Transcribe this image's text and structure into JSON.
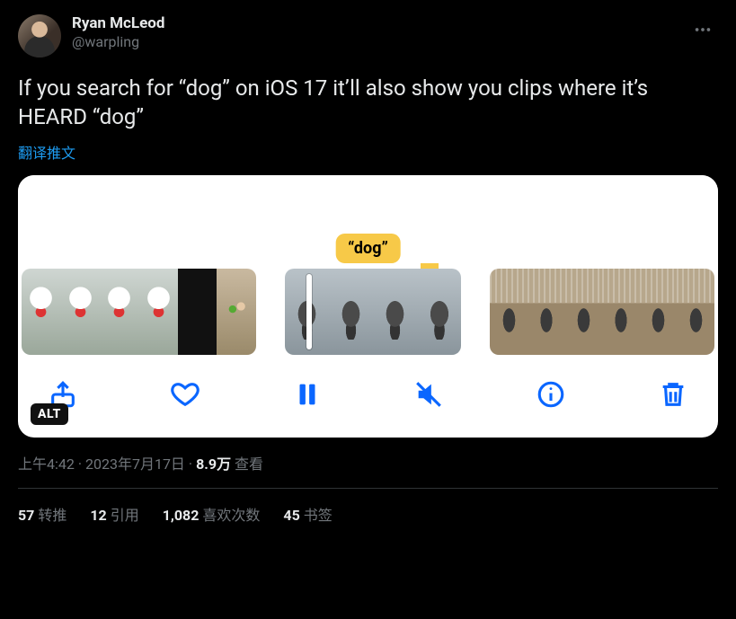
{
  "author": {
    "display_name": "Ryan McLeod",
    "handle": "@warpling"
  },
  "tweet_text": "If you search for “dog” on iOS 17 it’ll also show you clips where it’s HEARD “dog”",
  "translate_label": "翻译推文",
  "media": {
    "chip_label": "“dog”",
    "alt_badge": "ALT"
  },
  "meta": {
    "time": "上午4:42",
    "sep1": " · ",
    "date": "2023年7月17日",
    "sep2": " · ",
    "views_count": "8.9万",
    "views_label": " 查看"
  },
  "stats": {
    "retweets_count": "57",
    "retweets_label": "转推",
    "quotes_count": "12",
    "quotes_label": "引用",
    "likes_count": "1,082",
    "likes_label": "喜欢次数",
    "bookmarks_count": "45",
    "bookmarks_label": "书签"
  }
}
